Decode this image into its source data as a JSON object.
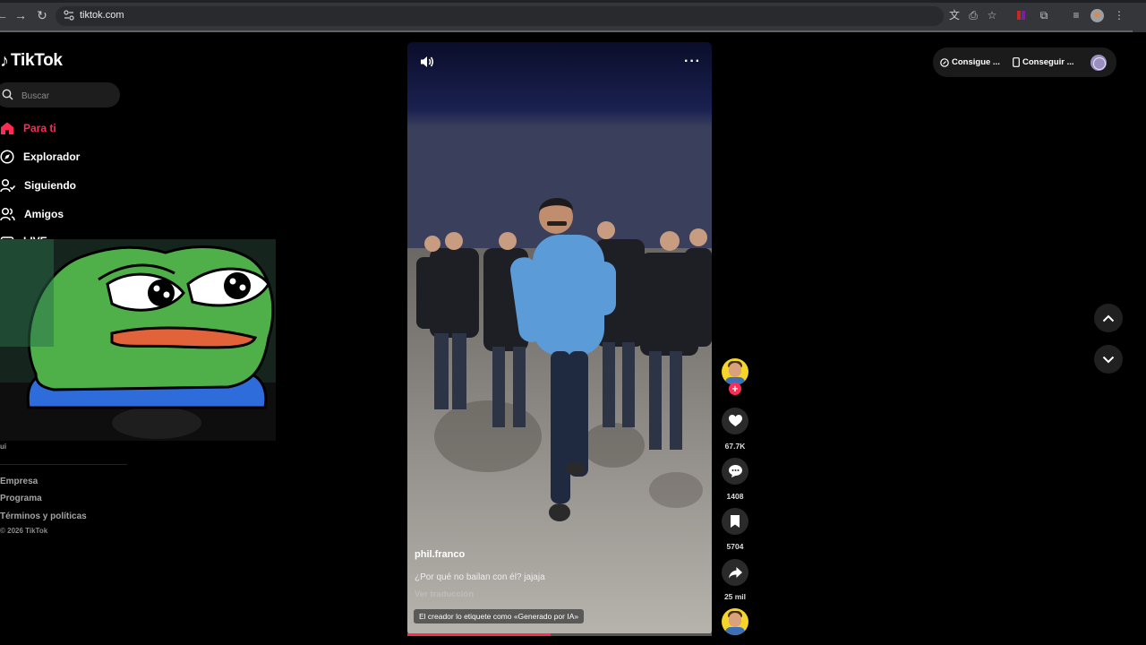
{
  "browser": {
    "url": "tiktok.com",
    "icons": [
      "back-icon",
      "forward-icon",
      "reload-icon",
      "translate-icon",
      "install-icon",
      "bookmark-star-icon",
      "record-icon",
      "extensions-icon",
      "tab-search-icon",
      "profile-icon",
      "menu-icon"
    ]
  },
  "sidebar": {
    "logo_text": "TikTok",
    "search_placeholder": "Buscar",
    "nav": [
      {
        "label": "Para ti",
        "icon": "home-icon",
        "active": true
      },
      {
        "label": "Explorador",
        "icon": "compass-icon",
        "active": false
      },
      {
        "label": "Siguiendo",
        "icon": "following-icon",
        "active": false
      },
      {
        "label": "Amigos",
        "icon": "friends-icon",
        "active": false
      },
      {
        "label": "LIVE",
        "icon": "live-icon",
        "active": false
      }
    ],
    "truncated_text": "ui",
    "footer": [
      "Empresa",
      "Programa",
      "Términos y políticas"
    ],
    "copyright": "© 2026 TikTok"
  },
  "video": {
    "author": "phil.franco",
    "caption": "¿Por qué no bailan con él? jajaja",
    "translate_label": "Ver traducción",
    "ai_label": "El creador lo etiquete como «Generado por IA»",
    "progress": 0.47,
    "actions": [
      {
        "name": "like",
        "icon": "heart-icon",
        "count": "67.7K"
      },
      {
        "name": "comment",
        "icon": "comment-icon",
        "count": "1408"
      },
      {
        "name": "save",
        "icon": "bookmark-icon",
        "count": "5704"
      },
      {
        "name": "share",
        "icon": "share-icon",
        "count": "25 mil"
      }
    ]
  },
  "header_right": {
    "get_app_label": "Consigue ...",
    "get_desktop_label": "Conseguir ..."
  },
  "colors": {
    "accent": "#fe2c55",
    "background": "#000000",
    "chrome": "#35363a"
  }
}
